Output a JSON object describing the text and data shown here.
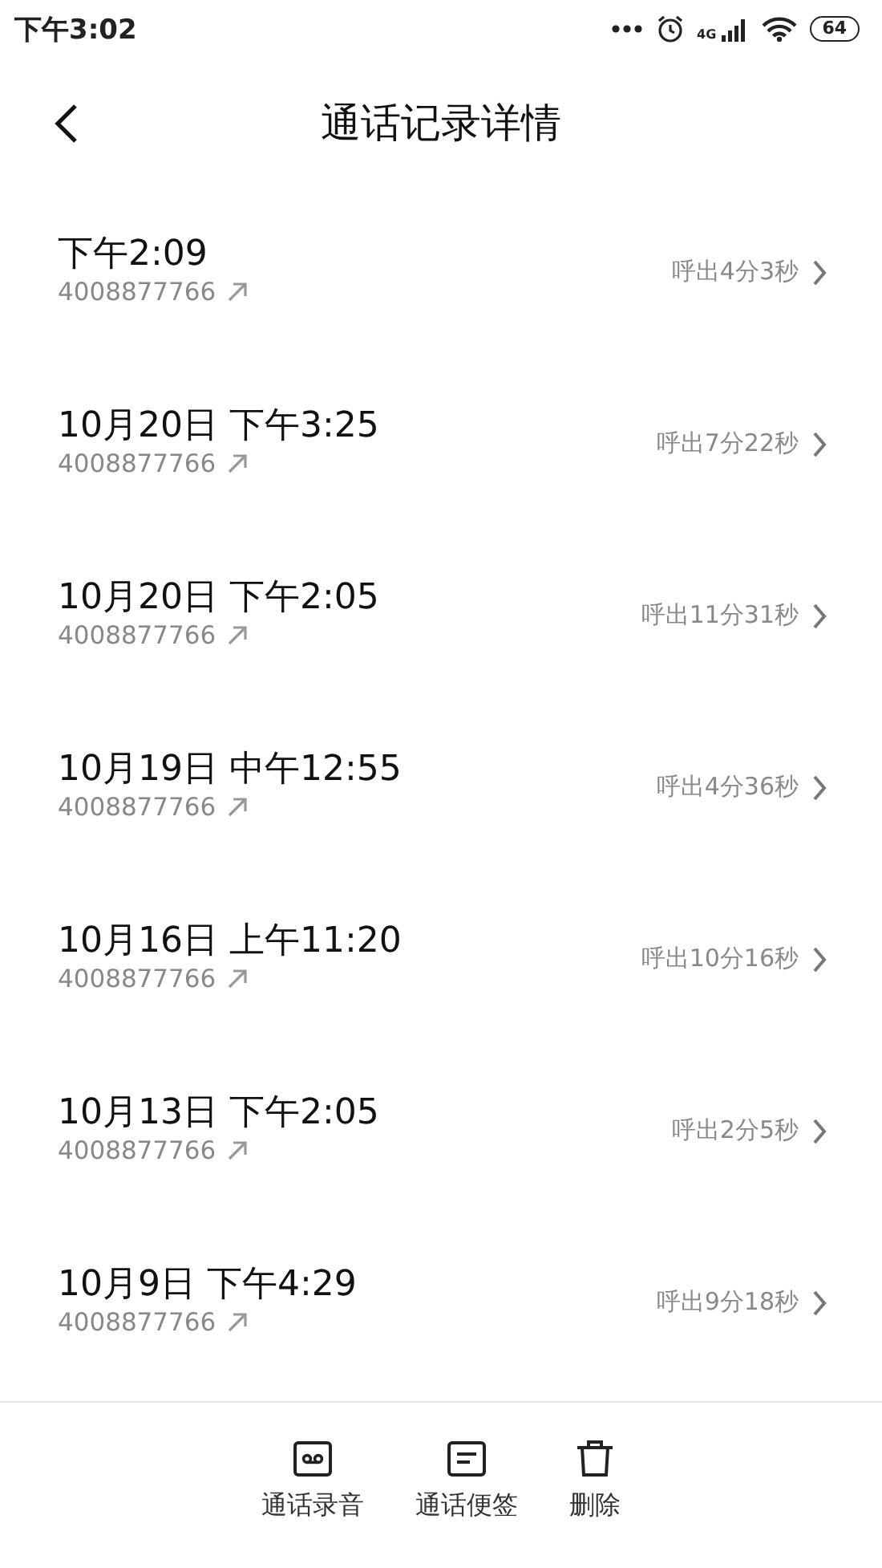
{
  "status_bar": {
    "time": "下午3:02",
    "network": "4G",
    "battery": "64"
  },
  "header": {
    "title": "通话记录详情"
  },
  "calls": [
    {
      "time": "下午2:09",
      "number": "4008877766",
      "summary": "呼出4分3秒"
    },
    {
      "time": "10月20日 下午3:25",
      "number": "4008877766",
      "summary": "呼出7分22秒"
    },
    {
      "time": "10月20日 下午2:05",
      "number": "4008877766",
      "summary": "呼出11分31秒"
    },
    {
      "time": "10月19日 中午12:55",
      "number": "4008877766",
      "summary": "呼出4分36秒"
    },
    {
      "time": "10月16日 上午11:20",
      "number": "4008877766",
      "summary": "呼出10分16秒"
    },
    {
      "time": "10月13日 下午2:05",
      "number": "4008877766",
      "summary": "呼出2分5秒"
    },
    {
      "time": "10月9日 下午4:29",
      "number": "4008877766",
      "summary": "呼出9分18秒"
    }
  ],
  "toolbar": [
    {
      "kind": "recording",
      "label": "通话录音"
    },
    {
      "kind": "note",
      "label": "通话便签"
    },
    {
      "kind": "delete",
      "label": "删除"
    }
  ]
}
